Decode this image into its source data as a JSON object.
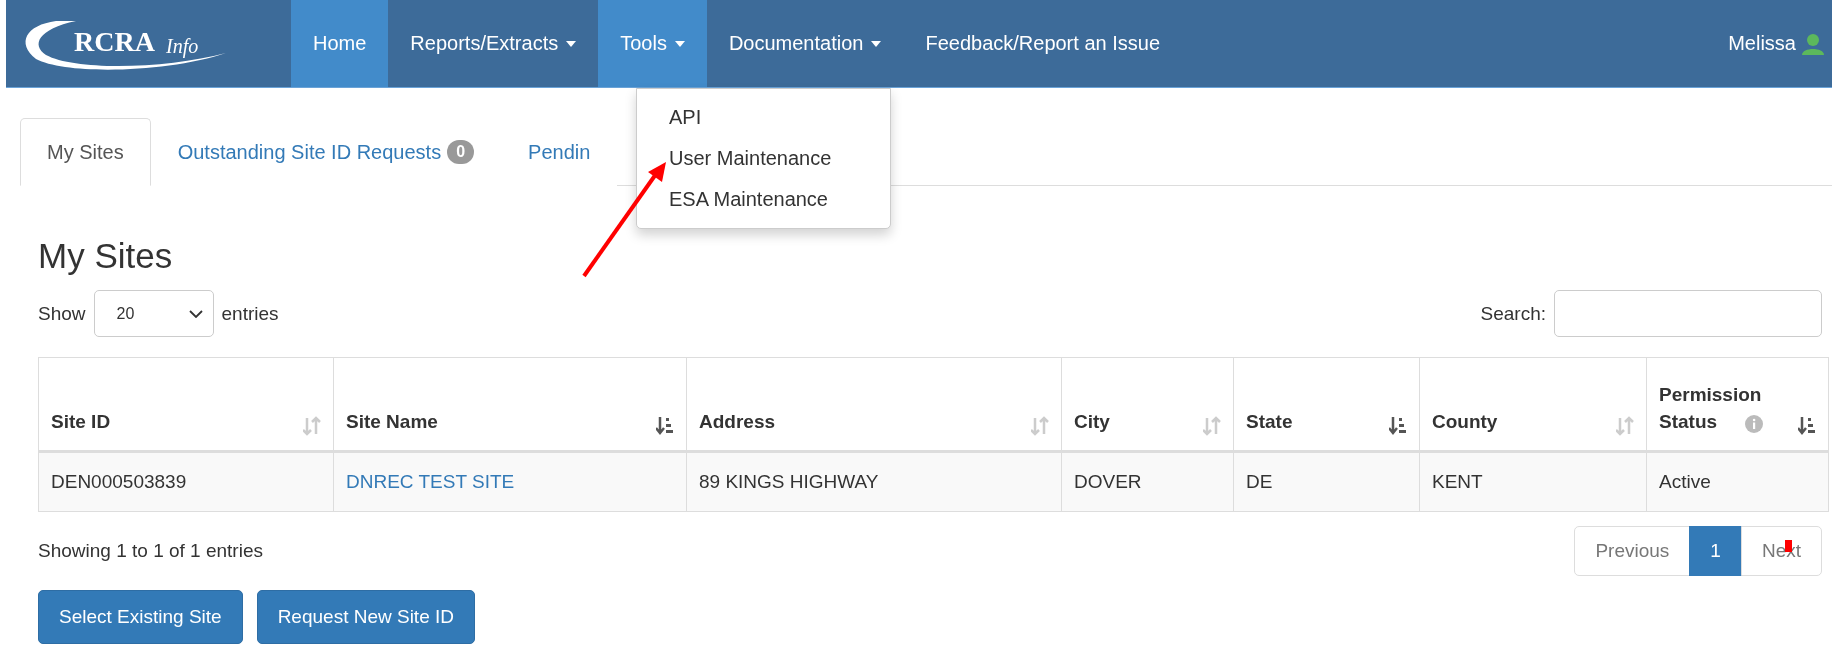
{
  "navbar": {
    "logo": {
      "main": "RCRA",
      "sub": "Info"
    },
    "items": [
      {
        "label": "Home",
        "highlighted": true,
        "caret": false
      },
      {
        "label": "Reports/Extracts",
        "highlighted": false,
        "caret": true
      },
      {
        "label": "Tools",
        "highlighted": true,
        "caret": true
      },
      {
        "label": "Documentation",
        "highlighted": false,
        "caret": true
      },
      {
        "label": "Feedback/Report an Issue",
        "highlighted": false,
        "caret": false
      }
    ],
    "user": "Melissa"
  },
  "tools_menu": {
    "items": [
      "API",
      "User Maintenance",
      "ESA Maintenance"
    ]
  },
  "tabs": [
    {
      "label": "My Sites",
      "selected": true
    },
    {
      "label": "Outstanding Site ID Requests",
      "badge": "0",
      "selected": false
    },
    {
      "label": "Pendin",
      "selected": false
    }
  ],
  "heading": "My Sites",
  "length_control": {
    "before": "Show",
    "value": "20",
    "after": "entries"
  },
  "search": {
    "label": "Search:"
  },
  "table": {
    "columns": [
      {
        "label": "Site ID",
        "sorted": false
      },
      {
        "label": "Site Name",
        "sorted": true
      },
      {
        "label": "Address",
        "sorted": false
      },
      {
        "label": "City",
        "sorted": false
      },
      {
        "label": "State",
        "sorted": true
      },
      {
        "label": "County",
        "sorted": false
      },
      {
        "label": "Permission Status",
        "sorted": true,
        "info": true
      }
    ],
    "rows": [
      {
        "cells": [
          {
            "text": "DEN000503839"
          },
          {
            "text": "DNREC TEST SITE",
            "kind": "link"
          },
          {
            "text": "89 KINGS HIGHWAY"
          },
          {
            "text": "DOVER"
          },
          {
            "text": "DE"
          },
          {
            "text": "KENT"
          },
          {
            "text": "Active"
          }
        ]
      }
    ]
  },
  "info": "Showing 1 to 1 of 1 entries",
  "pagination": [
    {
      "label": "Previous",
      "selected": false
    },
    {
      "label": "1",
      "selected": true
    },
    {
      "label": "Next",
      "selected": false
    }
  ],
  "buttons": [
    "Select Existing Site",
    "Request New Site ID"
  ]
}
